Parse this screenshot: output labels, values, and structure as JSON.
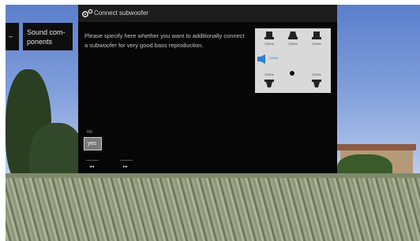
{
  "sidebar": {
    "items": [
      {
        "label": "–"
      },
      {
        "label_line1": "Sound com-",
        "label_line2": "ponents"
      }
    ]
  },
  "dialog": {
    "title": "Connect subwoofer",
    "description": "Please specify here whether you want to additionally connect a subwoofer for very good bass reproduction.",
    "option_label": "no",
    "selected_option": "yes",
    "nav_prev_symbol": "◂◂",
    "nav_next_symbol": "▸▸"
  },
  "speaker_diagram": {
    "speakers": [
      {
        "id": "front-left",
        "label": "220Hz"
      },
      {
        "id": "center",
        "label": "220Hz"
      },
      {
        "id": "front-right",
        "label": "220Hz"
      },
      {
        "id": "rear-left",
        "label": "220Hz"
      },
      {
        "id": "rear-right",
        "label": "220Hz"
      }
    ],
    "subwoofer": {
      "label": "220Hz"
    }
  },
  "colors": {
    "dialog_bg": "#060606",
    "accent_blue": "#2a7fd6",
    "button_bg": "#7a7a7a"
  }
}
